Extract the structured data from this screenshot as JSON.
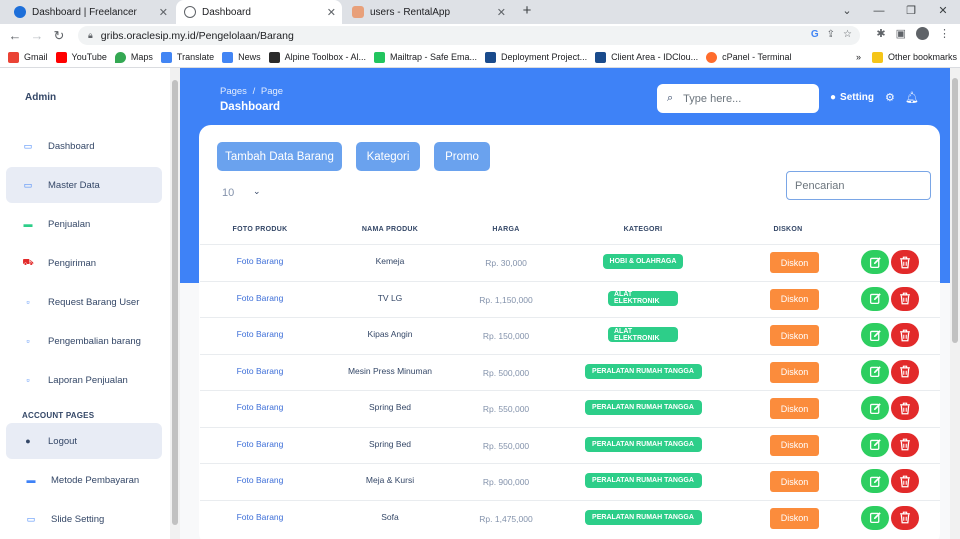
{
  "browser": {
    "tabs": [
      {
        "title": "Dashboard | Freelancer",
        "favicon_color": "#1e6fd9"
      },
      {
        "title": "Dashboard",
        "favicon_color": "#5f6368"
      },
      {
        "title": "users - RentalApp",
        "favicon_color": "#e8a07a"
      }
    ],
    "url": "gribs.oraclesip.my.id/Pengelolaan/Barang",
    "bookmarks": [
      {
        "label": "Gmail",
        "color": "#ea4335"
      },
      {
        "label": "YouTube",
        "color": "#ff0000"
      },
      {
        "label": "Maps",
        "color": "#34a853"
      },
      {
        "label": "Translate",
        "color": "#4285f4"
      },
      {
        "label": "News",
        "color": "#4285f4"
      },
      {
        "label": "Alpine Toolbox - Al...",
        "color": "#2b2b2b"
      },
      {
        "label": "Mailtrap - Safe Ema...",
        "color": "#22c55e"
      },
      {
        "label": "Deployment Project...",
        "color": "#1a4b8c"
      },
      {
        "label": "Client Area - IDClou...",
        "color": "#1a4b8c"
      },
      {
        "label": "cPanel - Terminal",
        "color": "#ff6c2c"
      }
    ],
    "other_bookmarks": "Other bookmarks"
  },
  "sidebar": {
    "brand": "Admin",
    "items": [
      {
        "label": "Dashboard",
        "icon": "monitor-icon",
        "active": false
      },
      {
        "label": "Master Data",
        "icon": "monitor-icon",
        "active": true
      },
      {
        "label": "Penjualan",
        "icon": "card-icon",
        "active": false
      },
      {
        "label": "Pengiriman",
        "icon": "truck-icon",
        "active": false
      },
      {
        "label": "Request Barang User",
        "icon": "box-icon",
        "active": false
      },
      {
        "label": "Pengembalian barang",
        "icon": "box-icon",
        "active": false
      },
      {
        "label": "Laporan Penjualan",
        "icon": "box-icon",
        "active": false
      }
    ],
    "section_label": "ACCOUNT PAGES",
    "account_items": [
      {
        "label": "Logout",
        "icon": "user-icon",
        "active": true
      },
      {
        "label": "Metode Pembayaran",
        "icon": "card-icon",
        "active": false
      },
      {
        "label": "Slide Setting",
        "icon": "monitor-icon",
        "active": false
      }
    ]
  },
  "header": {
    "breadcrumb_root": "Pages",
    "breadcrumb_sep": "/",
    "breadcrumb_current": "Page",
    "title": "Dashboard",
    "search_placeholder": "Type here...",
    "setting_label": "Setting"
  },
  "toolbar": {
    "add_label": "Tambah Data Barang",
    "kategori_label": "Kategori",
    "promo_label": "Promo",
    "per_page": "10",
    "search_placeholder": "Pencarian"
  },
  "table": {
    "headers": [
      "FOTO PRODUK",
      "NAMA PRODUK",
      "HARGA",
      "KATEGORI",
      "DISKON"
    ],
    "rows": [
      {
        "foto": "Foto Barang",
        "nama": "Kemeja",
        "harga": "Rp. 30,000",
        "kategori": "HOBI & OLAHRAGA",
        "diskon": "Diskon"
      },
      {
        "foto": "Foto Barang",
        "nama": "TV LG",
        "harga": "Rp. 1,150,000",
        "kategori": "ALAT ELEKTRONIK",
        "diskon": "Diskon"
      },
      {
        "foto": "Foto Barang",
        "nama": "Kipas Angin",
        "harga": "Rp. 150,000",
        "kategori": "ALAT ELEKTRONIK",
        "diskon": "Diskon"
      },
      {
        "foto": "Foto Barang",
        "nama": "Mesin Press Minuman",
        "harga": "Rp. 500,000",
        "kategori": "PERALATAN RUMAH TANGGA",
        "diskon": "Diskon"
      },
      {
        "foto": "Foto Barang",
        "nama": "Spring Bed",
        "harga": "Rp. 550,000",
        "kategori": "PERALATAN RUMAH TANGGA",
        "diskon": "Diskon"
      },
      {
        "foto": "Foto Barang",
        "nama": "Spring Bed",
        "harga": "Rp. 550,000",
        "kategori": "PERALATAN RUMAH TANGGA",
        "diskon": "Diskon"
      },
      {
        "foto": "Foto Barang",
        "nama": "Meja & Kursi",
        "harga": "Rp. 900,000",
        "kategori": "PERALATAN RUMAH TANGGA",
        "diskon": "Diskon"
      },
      {
        "foto": "Foto Barang",
        "nama": "Sofa",
        "harga": "Rp. 1,475,000",
        "kategori": "PERALATAN RUMAH TANGGA",
        "diskon": "Diskon"
      }
    ]
  },
  "colors": {
    "primary": "#3e82f7",
    "button": "#6aa2ee",
    "badge": "#2dce89",
    "discount": "#fb8c3c",
    "edit": "#2dce60",
    "delete": "#e22a2a"
  }
}
